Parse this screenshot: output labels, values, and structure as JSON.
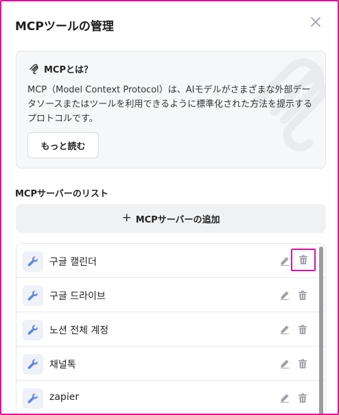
{
  "modal": {
    "title": "MCPツールの管理",
    "close_icon": "close-icon"
  },
  "info": {
    "icon": "mcp-logo-icon",
    "title": "MCPとは？",
    "description": "MCP（Model Context Protocol）は、AIモデルがさまざまな外部データソースまたはツールを利用できるように標準化された方法を提示するプロトコルです。",
    "more_label": "もっと読む"
  },
  "servers": {
    "section_label": "MCPサーバーのリスト",
    "add_label": "MCPサーバーの追加",
    "items": [
      {
        "name": "구글 캘린더"
      },
      {
        "name": "구글 드라이브"
      },
      {
        "name": "노션 전체 계정"
      },
      {
        "name": "채널톡"
      },
      {
        "name": "zapier"
      }
    ]
  },
  "colors": {
    "highlight": "#e60d9a",
    "icon_blue": "#5b86e0",
    "icon_gray": "#9ea2a8"
  }
}
